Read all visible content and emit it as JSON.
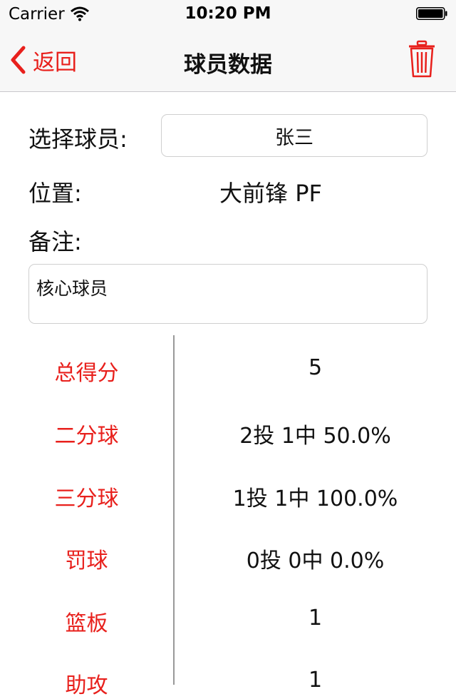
{
  "status_bar": {
    "carrier": "Carrier",
    "time": "10:20 PM"
  },
  "nav": {
    "back_label": "返回",
    "title": "球员数据"
  },
  "form": {
    "player_label": "选择球员:",
    "player_value": "张三",
    "position_label": "位置:",
    "position_value": "大前锋 PF",
    "note_label": "备注:",
    "note_value": "核心球员"
  },
  "stats": [
    {
      "label": "总得分",
      "value": "5"
    },
    {
      "label": "二分球",
      "value": "2投 1中 50.0%"
    },
    {
      "label": "三分球",
      "value": "1投 1中 100.0%"
    },
    {
      "label": "罚球",
      "value": "0投 0中 0.0%"
    },
    {
      "label": "篮板",
      "value": "1"
    },
    {
      "label": "助攻",
      "value": "1"
    }
  ],
  "colors": {
    "accent": "#e8201c",
    "text": "#111111",
    "nav_bg": "#f7f7f7"
  },
  "icons": [
    "wifi-icon",
    "battery-icon",
    "back-chevron-icon",
    "trash-icon"
  ]
}
